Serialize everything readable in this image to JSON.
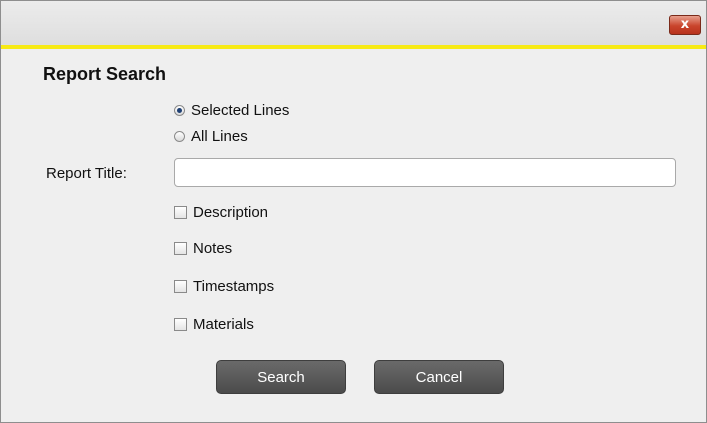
{
  "titlebar": {
    "close_label": "x"
  },
  "dialog": {
    "title": "Report Search",
    "scope_options": [
      {
        "label": "Selected Lines",
        "selected": true
      },
      {
        "label": "All Lines",
        "selected": false
      }
    ],
    "report_title_label": "Report Title:",
    "report_title_value": "",
    "checkboxes": [
      {
        "label": "Description",
        "checked": false
      },
      {
        "label": "Notes",
        "checked": false
      },
      {
        "label": "Timestamps",
        "checked": false
      },
      {
        "label": "Materials",
        "checked": false
      }
    ],
    "search_label": "Search",
    "cancel_label": "Cancel"
  },
  "colors": {
    "accent_line": "#f7ea14",
    "button_bg": "#555555",
    "close_bg": "#c9442c",
    "background": "#efefef"
  }
}
